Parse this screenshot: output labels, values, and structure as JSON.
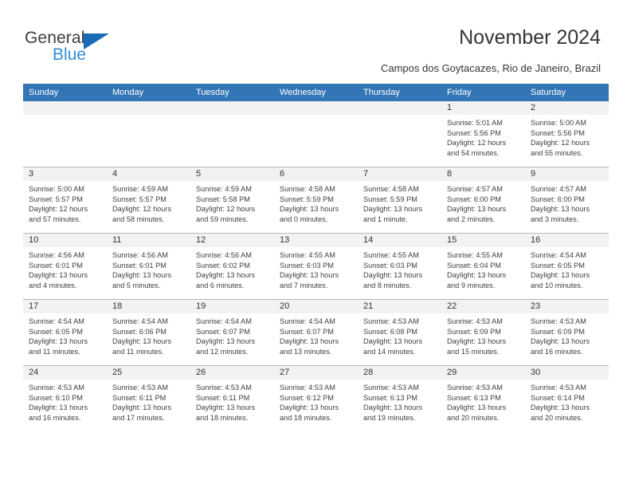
{
  "logo": {
    "word_top": "General",
    "word_bottom": "Blue",
    "triangle_color": "#1a6bb5",
    "blue_color": "#2f8fd6"
  },
  "header": {
    "title": "November 2024",
    "subtitle": "Campos dos Goytacazes, Rio de Janeiro, Brazil",
    "accent_color": "#3375b5"
  },
  "calendar": {
    "weekday_headers": [
      "Sunday",
      "Monday",
      "Tuesday",
      "Wednesday",
      "Thursday",
      "Friday",
      "Saturday"
    ],
    "weeks": [
      [
        {
          "date": "",
          "blank": true,
          "sunrise": "",
          "sunset": "",
          "daylight1": "",
          "daylight2": ""
        },
        {
          "date": "",
          "blank": true,
          "sunrise": "",
          "sunset": "",
          "daylight1": "",
          "daylight2": ""
        },
        {
          "date": "",
          "blank": true,
          "sunrise": "",
          "sunset": "",
          "daylight1": "",
          "daylight2": ""
        },
        {
          "date": "",
          "blank": true,
          "sunrise": "",
          "sunset": "",
          "daylight1": "",
          "daylight2": ""
        },
        {
          "date": "",
          "blank": true,
          "sunrise": "",
          "sunset": "",
          "daylight1": "",
          "daylight2": ""
        },
        {
          "date": "1",
          "sunrise": "Sunrise: 5:01 AM",
          "sunset": "Sunset: 5:56 PM",
          "daylight1": "Daylight: 12 hours",
          "daylight2": "and 54 minutes."
        },
        {
          "date": "2",
          "sunrise": "Sunrise: 5:00 AM",
          "sunset": "Sunset: 5:56 PM",
          "daylight1": "Daylight: 12 hours",
          "daylight2": "and 55 minutes."
        }
      ],
      [
        {
          "date": "3",
          "sunrise": "Sunrise: 5:00 AM",
          "sunset": "Sunset: 5:57 PM",
          "daylight1": "Daylight: 12 hours",
          "daylight2": "and 57 minutes."
        },
        {
          "date": "4",
          "sunrise": "Sunrise: 4:59 AM",
          "sunset": "Sunset: 5:57 PM",
          "daylight1": "Daylight: 12 hours",
          "daylight2": "and 58 minutes."
        },
        {
          "date": "5",
          "sunrise": "Sunrise: 4:59 AM",
          "sunset": "Sunset: 5:58 PM",
          "daylight1": "Daylight: 12 hours",
          "daylight2": "and 59 minutes."
        },
        {
          "date": "6",
          "sunrise": "Sunrise: 4:58 AM",
          "sunset": "Sunset: 5:59 PM",
          "daylight1": "Daylight: 13 hours",
          "daylight2": "and 0 minutes."
        },
        {
          "date": "7",
          "sunrise": "Sunrise: 4:58 AM",
          "sunset": "Sunset: 5:59 PM",
          "daylight1": "Daylight: 13 hours",
          "daylight2": "and 1 minute."
        },
        {
          "date": "8",
          "sunrise": "Sunrise: 4:57 AM",
          "sunset": "Sunset: 6:00 PM",
          "daylight1": "Daylight: 13 hours",
          "daylight2": "and 2 minutes."
        },
        {
          "date": "9",
          "sunrise": "Sunrise: 4:57 AM",
          "sunset": "Sunset: 6:00 PM",
          "daylight1": "Daylight: 13 hours",
          "daylight2": "and 3 minutes."
        }
      ],
      [
        {
          "date": "10",
          "sunrise": "Sunrise: 4:56 AM",
          "sunset": "Sunset: 6:01 PM",
          "daylight1": "Daylight: 13 hours",
          "daylight2": "and 4 minutes."
        },
        {
          "date": "11",
          "sunrise": "Sunrise: 4:56 AM",
          "sunset": "Sunset: 6:01 PM",
          "daylight1": "Daylight: 13 hours",
          "daylight2": "and 5 minutes."
        },
        {
          "date": "12",
          "sunrise": "Sunrise: 4:56 AM",
          "sunset": "Sunset: 6:02 PM",
          "daylight1": "Daylight: 13 hours",
          "daylight2": "and 6 minutes."
        },
        {
          "date": "13",
          "sunrise": "Sunrise: 4:55 AM",
          "sunset": "Sunset: 6:03 PM",
          "daylight1": "Daylight: 13 hours",
          "daylight2": "and 7 minutes."
        },
        {
          "date": "14",
          "sunrise": "Sunrise: 4:55 AM",
          "sunset": "Sunset: 6:03 PM",
          "daylight1": "Daylight: 13 hours",
          "daylight2": "and 8 minutes."
        },
        {
          "date": "15",
          "sunrise": "Sunrise: 4:55 AM",
          "sunset": "Sunset: 6:04 PM",
          "daylight1": "Daylight: 13 hours",
          "daylight2": "and 9 minutes."
        },
        {
          "date": "16",
          "sunrise": "Sunrise: 4:54 AM",
          "sunset": "Sunset: 6:05 PM",
          "daylight1": "Daylight: 13 hours",
          "daylight2": "and 10 minutes."
        }
      ],
      [
        {
          "date": "17",
          "sunrise": "Sunrise: 4:54 AM",
          "sunset": "Sunset: 6:05 PM",
          "daylight1": "Daylight: 13 hours",
          "daylight2": "and 11 minutes."
        },
        {
          "date": "18",
          "sunrise": "Sunrise: 4:54 AM",
          "sunset": "Sunset: 6:06 PM",
          "daylight1": "Daylight: 13 hours",
          "daylight2": "and 11 minutes."
        },
        {
          "date": "19",
          "sunrise": "Sunrise: 4:54 AM",
          "sunset": "Sunset: 6:07 PM",
          "daylight1": "Daylight: 13 hours",
          "daylight2": "and 12 minutes."
        },
        {
          "date": "20",
          "sunrise": "Sunrise: 4:54 AM",
          "sunset": "Sunset: 6:07 PM",
          "daylight1": "Daylight: 13 hours",
          "daylight2": "and 13 minutes."
        },
        {
          "date": "21",
          "sunrise": "Sunrise: 4:53 AM",
          "sunset": "Sunset: 6:08 PM",
          "daylight1": "Daylight: 13 hours",
          "daylight2": "and 14 minutes."
        },
        {
          "date": "22",
          "sunrise": "Sunrise: 4:53 AM",
          "sunset": "Sunset: 6:09 PM",
          "daylight1": "Daylight: 13 hours",
          "daylight2": "and 15 minutes."
        },
        {
          "date": "23",
          "sunrise": "Sunrise: 4:53 AM",
          "sunset": "Sunset: 6:09 PM",
          "daylight1": "Daylight: 13 hours",
          "daylight2": "and 16 minutes."
        }
      ],
      [
        {
          "date": "24",
          "sunrise": "Sunrise: 4:53 AM",
          "sunset": "Sunset: 6:10 PM",
          "daylight1": "Daylight: 13 hours",
          "daylight2": "and 16 minutes."
        },
        {
          "date": "25",
          "sunrise": "Sunrise: 4:53 AM",
          "sunset": "Sunset: 6:11 PM",
          "daylight1": "Daylight: 13 hours",
          "daylight2": "and 17 minutes."
        },
        {
          "date": "26",
          "sunrise": "Sunrise: 4:53 AM",
          "sunset": "Sunset: 6:11 PM",
          "daylight1": "Daylight: 13 hours",
          "daylight2": "and 18 minutes."
        },
        {
          "date": "27",
          "sunrise": "Sunrise: 4:53 AM",
          "sunset": "Sunset: 6:12 PM",
          "daylight1": "Daylight: 13 hours",
          "daylight2": "and 18 minutes."
        },
        {
          "date": "28",
          "sunrise": "Sunrise: 4:53 AM",
          "sunset": "Sunset: 6:13 PM",
          "daylight1": "Daylight: 13 hours",
          "daylight2": "and 19 minutes."
        },
        {
          "date": "29",
          "sunrise": "Sunrise: 4:53 AM",
          "sunset": "Sunset: 6:13 PM",
          "daylight1": "Daylight: 13 hours",
          "daylight2": "and 20 minutes."
        },
        {
          "date": "30",
          "sunrise": "Sunrise: 4:53 AM",
          "sunset": "Sunset: 6:14 PM",
          "daylight1": "Daylight: 13 hours",
          "daylight2": "and 20 minutes."
        }
      ]
    ]
  }
}
